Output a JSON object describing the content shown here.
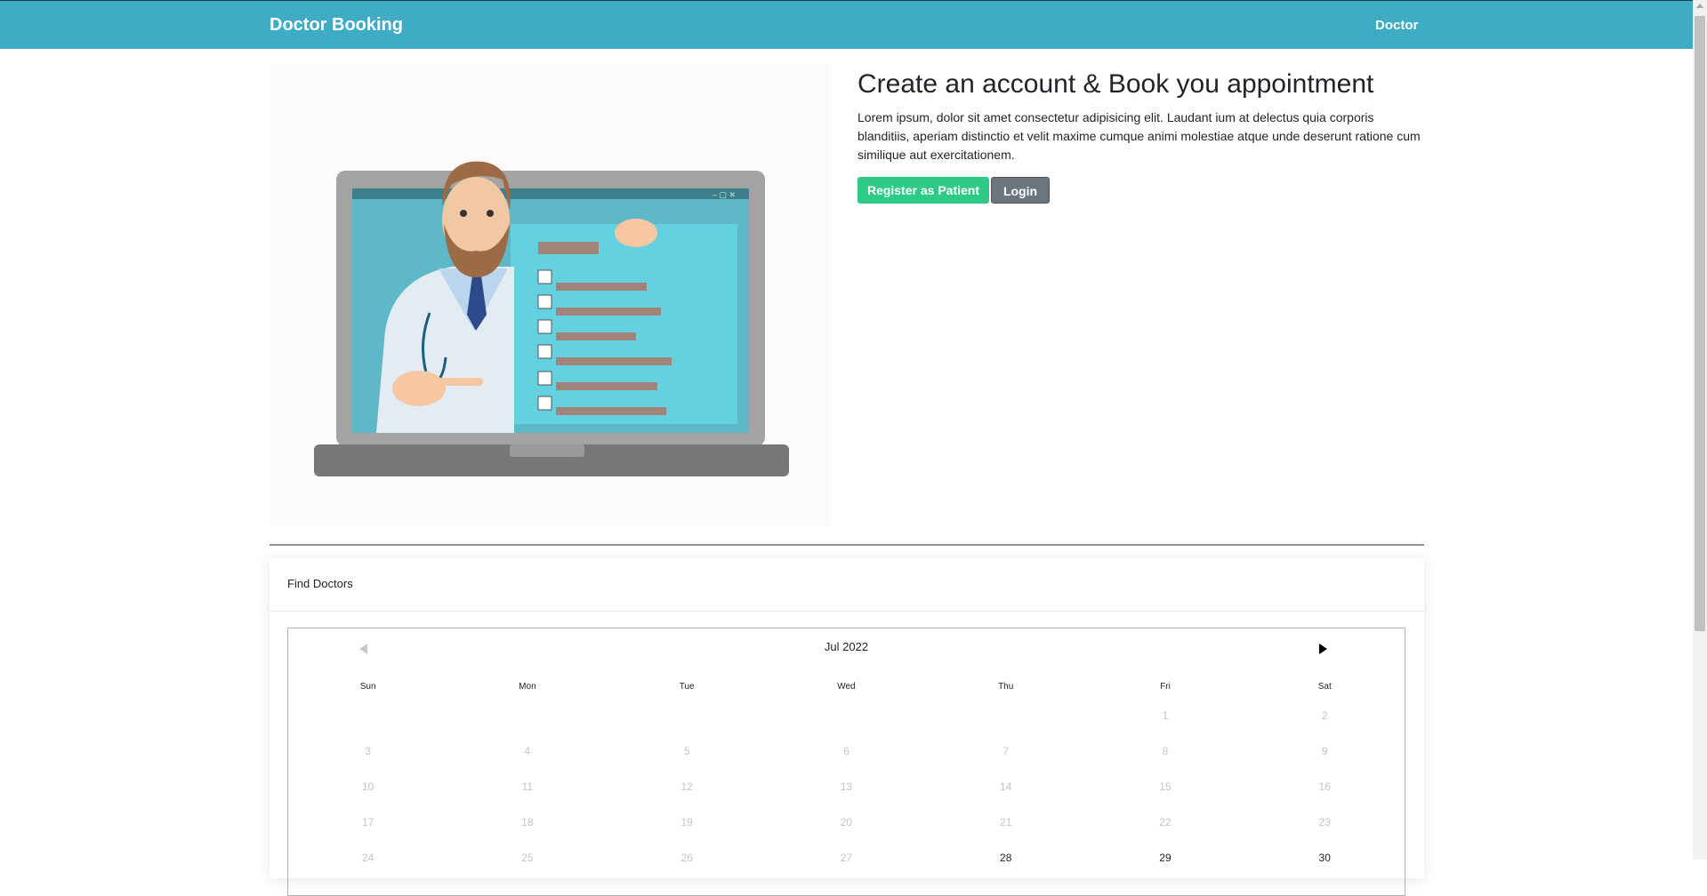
{
  "navbar": {
    "brand": "Doctor Booking",
    "link": "Doctor"
  },
  "hero": {
    "title": "Create an account & Book you appointment",
    "description": "Lorem ipsum, dolor sit amet consectetur adipisicing elit. Laudant ium at delectus quia corporis blanditiis, aperiam distinctio et velit maxime cumque animi molestiae atque unde deserunt ratione cum similique aut exercitationem.",
    "register_label": "Register as Patient",
    "login_label": "Login"
  },
  "find_doctors": {
    "header": "Find Doctors",
    "calendar": {
      "month_label": "Jul 2022",
      "weekdays": [
        "Sun",
        "Mon",
        "Tue",
        "Wed",
        "Thu",
        "Fri",
        "Sat"
      ],
      "weeks": [
        [
          "",
          "",
          "",
          "",
          "",
          "1",
          "2"
        ],
        [
          "3",
          "4",
          "5",
          "6",
          "7",
          "8",
          "9"
        ],
        [
          "10",
          "11",
          "12",
          "13",
          "14",
          "15",
          "16"
        ],
        [
          "17",
          "18",
          "19",
          "20",
          "21",
          "22",
          "23"
        ],
        [
          "24",
          "25",
          "26",
          "27",
          "28",
          "29",
          "30"
        ]
      ],
      "available_days": [
        "28",
        "29",
        "30"
      ]
    }
  },
  "colors": {
    "navbar": "#3eacc4",
    "success": "#2dcb86",
    "secondary": "#6c757d"
  }
}
